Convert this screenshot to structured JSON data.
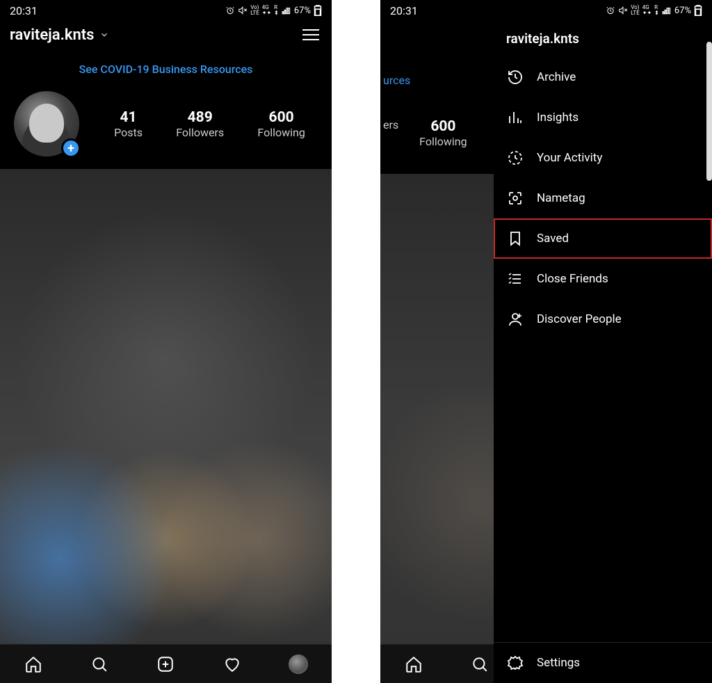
{
  "status": {
    "time": "20:31",
    "battery": "67%",
    "signals": "Vo) 4G R LTE"
  },
  "profile": {
    "username": "raviteja.knts",
    "covid_banner": "See COVID-19 Business Resources",
    "covid_partial": "urces",
    "stats": [
      {
        "value": "41",
        "label": "Posts"
      },
      {
        "value": "489",
        "label": "Followers"
      },
      {
        "value": "600",
        "label": "Following"
      }
    ],
    "partial_stats": [
      {
        "value": "",
        "label": "ers"
      },
      {
        "value": "600",
        "label": "Following"
      }
    ]
  },
  "nav": {
    "home": "Home",
    "search": "Search",
    "add": "Add",
    "activity": "Activity",
    "me": "Profile"
  },
  "drawer": {
    "title": "raviteja.knts",
    "items": [
      {
        "label": "Archive",
        "icon": "archive-icon"
      },
      {
        "label": "Insights",
        "icon": "insights-icon"
      },
      {
        "label": "Your Activity",
        "icon": "activity-icon"
      },
      {
        "label": "Nametag",
        "icon": "nametag-icon"
      },
      {
        "label": "Saved",
        "icon": "saved-icon",
        "highlighted": true
      },
      {
        "label": "Close Friends",
        "icon": "close-friends-icon"
      },
      {
        "label": "Discover People",
        "icon": "discover-people-icon"
      }
    ],
    "footer": {
      "label": "Settings",
      "icon": "settings-icon"
    }
  }
}
